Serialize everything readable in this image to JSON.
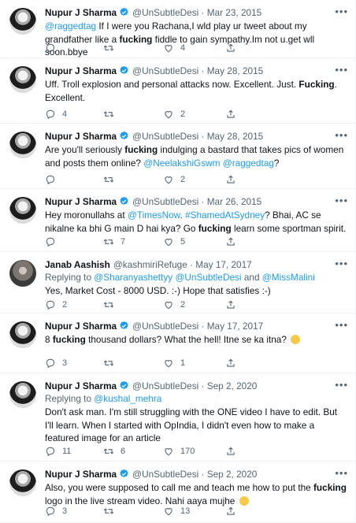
{
  "tweets": [
    {
      "name": "Nupur J Sharma",
      "handle": "@UnSubtleDesi",
      "date": "Mar 23, 2015",
      "verified": true,
      "reply_to": null,
      "body": [
        {
          "t": "@raggedtag",
          "c": "m"
        },
        {
          "t": " If I were you Rachana,I wld play ur tweet about my grandfather like a ",
          "c": ""
        },
        {
          "t": "fucking",
          "c": "b"
        },
        {
          "t": " fiddle to gain sympathy.Im not u.get wll soon.bbye",
          "c": ""
        }
      ],
      "replies": "",
      "retweets": "",
      "likes": "4"
    },
    {
      "name": "Nupur J Sharma",
      "handle": "@UnSubtleDesi",
      "date": "May 28, 2015",
      "verified": true,
      "reply_to": null,
      "body": [
        {
          "t": "Uff. Troll explosion and personal attacks now. Excellent. Just. ",
          "c": ""
        },
        {
          "t": "Fucking",
          "c": "b"
        },
        {
          "t": ". Excellent.",
          "c": ""
        }
      ],
      "replies": "4",
      "retweets": "",
      "likes": "2"
    },
    {
      "name": "Nupur J Sharma",
      "handle": "@UnSubtleDesi",
      "date": "May 28, 2015",
      "verified": true,
      "reply_to": null,
      "body": [
        {
          "t": "Are you'll seriously ",
          "c": ""
        },
        {
          "t": "fucking",
          "c": "b"
        },
        {
          "t": " indulging a bastard that takes pics of women and posts them online? ",
          "c": ""
        },
        {
          "t": "@NeelakshiGswm",
          "c": "m"
        },
        {
          "t": " ",
          "c": ""
        },
        {
          "t": "@raggedtag",
          "c": "m"
        },
        {
          "t": "?",
          "c": ""
        }
      ],
      "replies": "",
      "retweets": "",
      "likes": "2"
    },
    {
      "name": "Nupur J Sharma",
      "handle": "@UnSubtleDesi",
      "date": "Mar 26, 2015",
      "verified": true,
      "reply_to": null,
      "body": [
        {
          "t": "Hey moronullahs at ",
          "c": ""
        },
        {
          "t": "@TimesNow",
          "c": "m"
        },
        {
          "t": ". ",
          "c": ""
        },
        {
          "t": "#ShamedAtSydney",
          "c": "m"
        },
        {
          "t": "? Bhai, AC se nikalne ka bhi G main D hai kya? Go ",
          "c": ""
        },
        {
          "t": "fucking",
          "c": "b"
        },
        {
          "t": " learn some sportman spirit.",
          "c": ""
        }
      ],
      "replies": "",
      "retweets": "7",
      "likes": "5"
    },
    {
      "name": "Janab Aashish",
      "handle": "@kashmiriRefuge",
      "date": "May 17, 2017",
      "verified": false,
      "reply_to": [
        {
          "t": "Replying to ",
          "c": ""
        },
        {
          "t": "@Sharanyashettyy",
          "c": "m"
        },
        {
          "t": " ",
          "c": ""
        },
        {
          "t": "@UnSubtleDesi",
          "c": "m"
        },
        {
          "t": " and ",
          "c": ""
        },
        {
          "t": "@MissMalini",
          "c": "m"
        }
      ],
      "body": [
        {
          "t": "Yes, Market Cost - 8000 USD. :-) Hope that satisfies :-)",
          "c": ""
        }
      ],
      "replies": "2",
      "retweets": "",
      "likes": "2"
    },
    {
      "name": "Nupur J Sharma",
      "handle": "@UnSubtleDesi",
      "date": "May 17, 2017",
      "verified": true,
      "reply_to": null,
      "body": [
        {
          "t": "8 ",
          "c": ""
        },
        {
          "t": "fucking",
          "c": "b"
        },
        {
          "t": " thousand dollars? What the hell! Itne se ka itna? ",
          "c": ""
        }
      ],
      "emoji": "scream",
      "replies": "3",
      "retweets": "",
      "likes": "1"
    },
    {
      "name": "Nupur J Sharma",
      "handle": "@UnSubtleDesi",
      "date": "Sep 2, 2020",
      "verified": true,
      "reply_to": [
        {
          "t": "Replying to ",
          "c": ""
        },
        {
          "t": "@kushal_mehra",
          "c": "m"
        }
      ],
      "body": [
        {
          "t": "Don't ask man. I'm still struggling with the ONE video I have to edit. But I'll learn. When I started with OpIndia, I didn't even how to make a featured image for an article",
          "c": ""
        }
      ],
      "replies": "11",
      "retweets": "6",
      "likes": "170"
    },
    {
      "name": "Nupur J Sharma",
      "handle": "@UnSubtleDesi",
      "date": "Sep 2, 2020",
      "verified": true,
      "reply_to": null,
      "body": [
        {
          "t": "Also, you were supposed to call me and teach me how to put the ",
          "c": ""
        },
        {
          "t": "fucking",
          "c": "b"
        },
        {
          "t": " logo in the live stream video. Nahi aaya mujhe ",
          "c": ""
        }
      ],
      "emoji": "grimace",
      "replies": "3",
      "retweets": "",
      "likes": "13"
    }
  ],
  "colors": {
    "link": "#1d9bf0",
    "muted": "#536471",
    "verified": "#1d9bf0",
    "divider": "#eff3f4"
  },
  "icons": {
    "reply": "reply-icon",
    "retweet": "retweet-icon",
    "like": "heart-icon",
    "share": "share-icon",
    "more": "more-icon",
    "verified": "verified-badge-icon"
  }
}
